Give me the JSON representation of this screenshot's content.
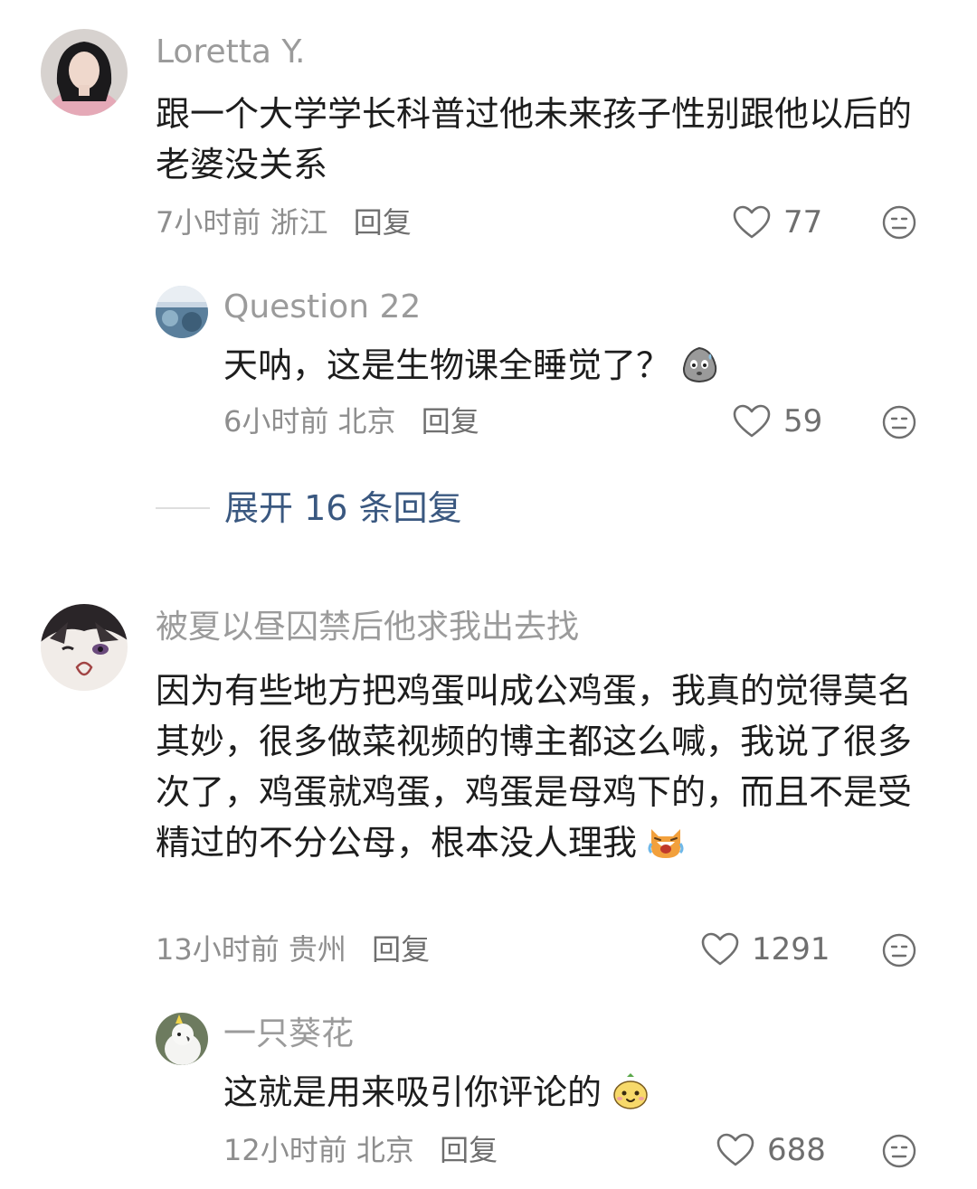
{
  "comments": [
    {
      "user": "Loretta Y.",
      "text": "跟一个大学学长科普过他未来孩子性别跟他以后的老婆没关系",
      "time": "7小时前",
      "location": "浙江",
      "reply_label": "回复",
      "likes": "77",
      "replies": [
        {
          "user": "Question 22",
          "text": "天呐，这是生物课全睡觉了？",
          "time": "6小时前",
          "location": "北京",
          "reply_label": "回复",
          "likes": "59",
          "emoji": "sweat-face-icon"
        }
      ],
      "expand_label": "展开 16 条回复"
    },
    {
      "user": "被夏以昼囚禁后他求我出去找",
      "text": "因为有些地方把鸡蛋叫成公鸡蛋，我真的觉得莫名其妙，很多做菜视频的博主都这么喊，我说了很多次了，鸡蛋就鸡蛋，鸡蛋是母鸡下的，而且不是受精过的不分公母，根本没人理我",
      "time": "13小时前",
      "location": "贵州",
      "reply_label": "回复",
      "likes": "1291",
      "emoji": "laughing-cat-icon",
      "replies": [
        {
          "user": "一只葵花",
          "text": "这就是用来吸引你评论的",
          "time": "12小时前",
          "location": "北京",
          "reply_label": "回复",
          "likes": "688",
          "emoji": "smirk-bun-icon"
        }
      ]
    }
  ],
  "colors": {
    "meta": "#8e8e8e",
    "username": "#9b9b9b",
    "expand": "#3a5880"
  }
}
